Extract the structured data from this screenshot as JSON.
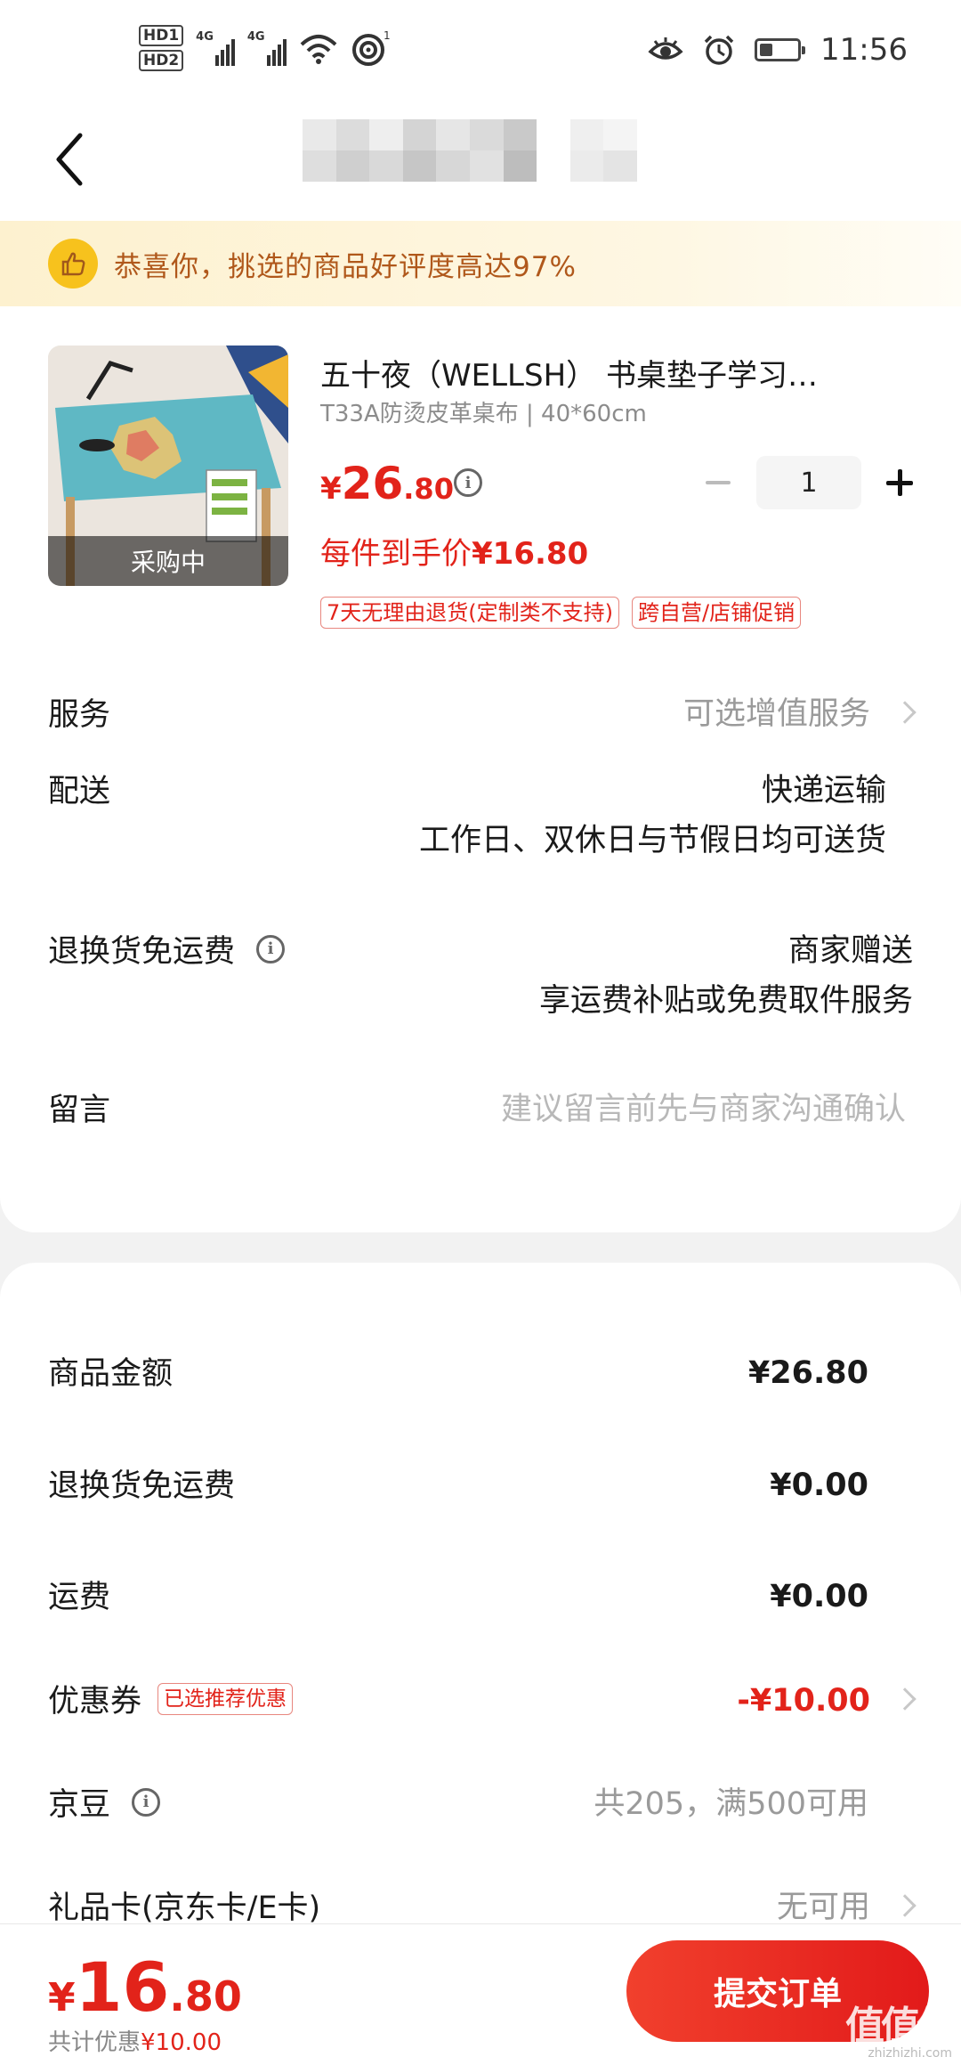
{
  "status_bar": {
    "sim1": "HD1",
    "sim2": "HD2",
    "net1": "4G",
    "net2": "4G",
    "hotspot_count": "1",
    "time": "11:56",
    "battery_percent": 40
  },
  "nav": {
    "title_blurred": true
  },
  "banner": {
    "text": "恭喜你，挑选的商品好评度高达97%"
  },
  "product": {
    "image_overlay": "采购中",
    "title": "五十夜（WELLSH） 书桌垫子学习…",
    "spec": "T33A防烫皮革桌布 | 40*60cm",
    "price_currency": "¥",
    "price_int": "26",
    "price_dec": ".80",
    "unit_price_label": "每件到手价",
    "unit_price_value": "¥16.80",
    "quantity": "1",
    "tags": [
      "7天无理由退货(定制类不支持)",
      "跨自营/店铺促销"
    ]
  },
  "service": {
    "label": "服务",
    "value": "可选增值服务"
  },
  "delivery": {
    "label": "配送",
    "line1": "快递运输",
    "line2": "工作日、双休日与节假日均可送货"
  },
  "return_freight": {
    "label": "退换货免运费",
    "line1": "商家赠送",
    "line2": "享运费补贴或免费取件服务"
  },
  "message": {
    "label": "留言",
    "placeholder": "建议留言前先与商家沟通确认"
  },
  "summary": {
    "goods_amount": {
      "label": "商品金额",
      "value": "¥26.80"
    },
    "return_freight_fee": {
      "label": "退换货免运费",
      "value": "¥0.00"
    },
    "shipping": {
      "label": "运费",
      "value": "¥0.00"
    },
    "coupon": {
      "label": "优惠券",
      "badge": "已选推荐优惠",
      "value": "-¥10.00"
    },
    "jingdou": {
      "label": "京豆",
      "value": "共205，满500可用"
    },
    "gift_card": {
      "label": "礼品卡(京东卡/E卡)",
      "value": "无可用"
    }
  },
  "bottom": {
    "total_currency": "¥",
    "total_int": "16",
    "total_dec": ".80",
    "discount_label": "共计优惠",
    "discount_value": "¥10.00",
    "submit_label": "提交订单",
    "watermark_text": "值值值",
    "watermark_url": "zhizhizhi.com"
  },
  "colors": {
    "accent_red": "#e2231a",
    "banner_text": "#b0581b",
    "thumb_yellow": "#f7c21d"
  }
}
